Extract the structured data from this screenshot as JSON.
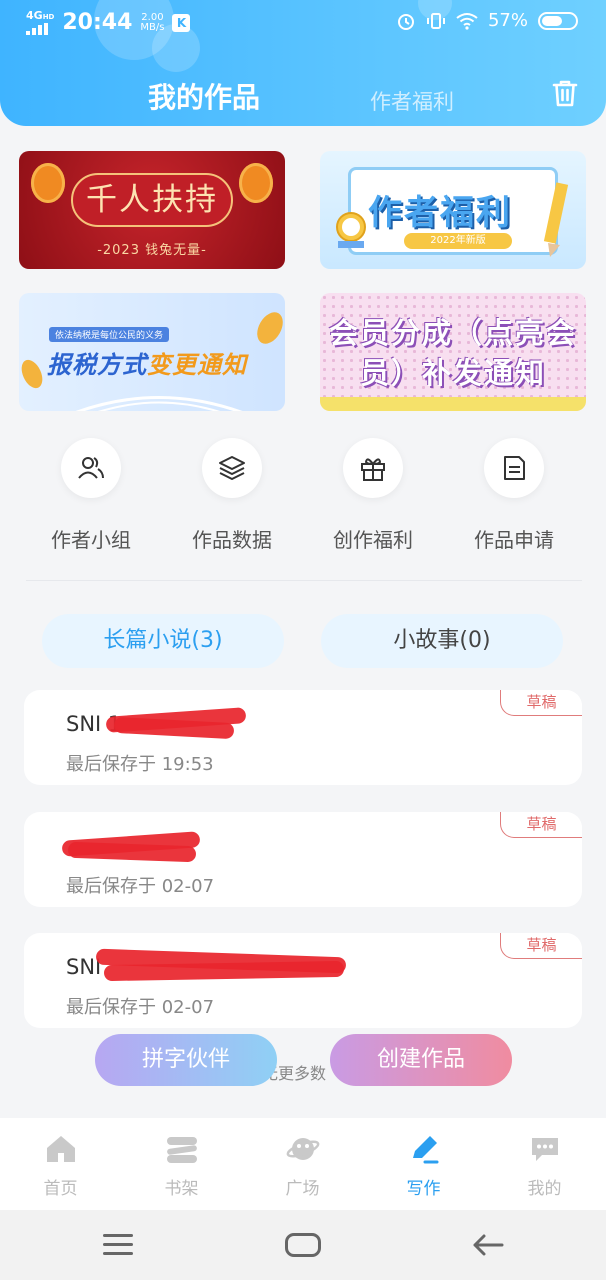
{
  "status_bar": {
    "network": "4G",
    "network_sup": "HD",
    "time": "20:44",
    "speed_value": "2.00",
    "speed_unit": "MB/s",
    "app_badge": "K",
    "battery": "57%"
  },
  "header": {
    "tab_active": "我的作品",
    "tab_inactive": "作者福利",
    "colors": {
      "gradient_start": "#3fb4ff",
      "gradient_end": "#6fd0ff"
    }
  },
  "banners": [
    {
      "title": "千人扶持",
      "subtitle": "-2023 钱兔无量-"
    },
    {
      "title": "作者福利",
      "tag": "2022年新版"
    },
    {
      "small": "依法纳税是每位公民的义务",
      "title_a": "报税方式",
      "title_b": "变更通知"
    },
    {
      "title": "会员分成（点亮会员）补发通知"
    }
  ],
  "quick_actions": [
    {
      "label": "作者小组",
      "icon": "author-group-icon"
    },
    {
      "label": "作品数据",
      "icon": "layers-icon"
    },
    {
      "label": "创作福利",
      "icon": "gift-icon"
    },
    {
      "label": "作品申请",
      "icon": "document-icon"
    }
  ],
  "segments": {
    "novel": "长篇小说(3)",
    "story": "小故事(0)"
  },
  "works": [
    {
      "title": "SNI 1",
      "saved": "最后保存于 19:53",
      "status": "草稿"
    },
    {
      "title": "",
      "saved": "最后保存于 02-07",
      "status": "草稿"
    },
    {
      "title": "SNI",
      "saved": "最后保存于 02-07",
      "status": "草稿"
    }
  ],
  "list_footer": "无更多数",
  "floating_buttons": {
    "partner": "拼字伙伴",
    "create": "创建作品"
  },
  "bottom_nav": [
    {
      "label": "首页",
      "icon": "home-icon"
    },
    {
      "label": "书架",
      "icon": "bookshelf-icon"
    },
    {
      "label": "广场",
      "icon": "planet-icon"
    },
    {
      "label": "写作",
      "icon": "pen-icon",
      "active": true
    },
    {
      "label": "我的",
      "icon": "chat-icon"
    }
  ]
}
